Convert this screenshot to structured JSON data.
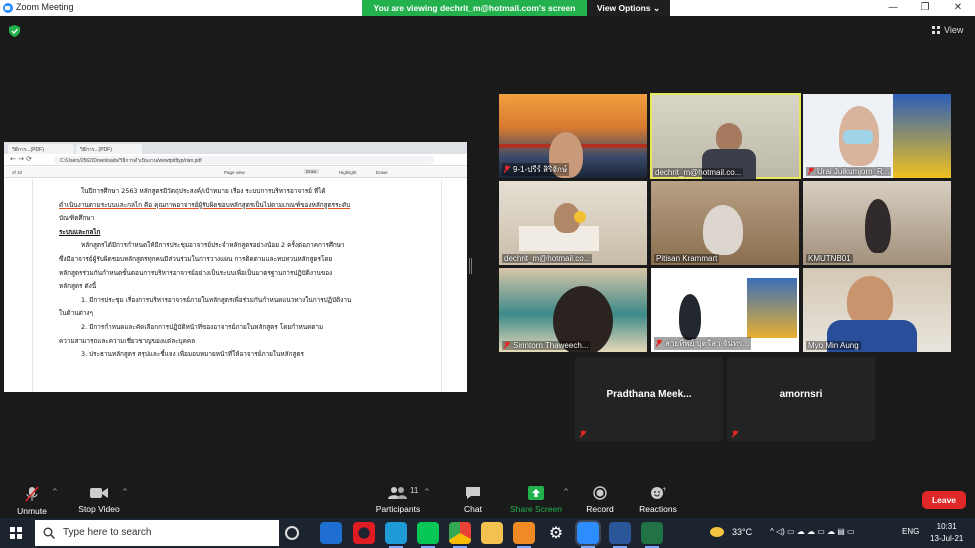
{
  "window": {
    "title": "Zoom Meeting"
  },
  "banner": {
    "message": "You are viewing dechrit_m@hotmail.com's screen",
    "view_options": "View Options ⌄"
  },
  "top": {
    "view_label": "View"
  },
  "shared_screen": {
    "tabs": [
      "วิธีการ...(PDF)",
      "วิธีการ...(PDF)"
    ],
    "url": "C:/Users/2562/Downloads/วิธีการดำเนินงาน/wewtpdftyp/rian.pdf",
    "pdf_toolbar": {
      "page": "of 10",
      "page_view": "Page view",
      "draw": "Draw",
      "highlight": "Highlight",
      "erase": "Erase"
    },
    "lines": [
      "ในปีการศึกษา 2563 หลักสูตรมีวัตถุประสงค์/เป้าหมาย เรื่อง ระบบการบริหารอาจารย์ ที่ได้",
      "ดำเนินงานตามระบบและกลไก คือ คุณภาพอาจารย์ผู้รับผิดชอบหลักสูตรเป็นไปตามเกณฑ์ของหลักสูตรระดับ",
      "บัณฑิตศึกษา",
      "ระบบและกลไก",
      "หลักสูตรได้มีการกำหนดให้มีการประชุมอาจารย์ประจำหลักสูตรอย่างน้อย 2 ครั้งต่อภาคการศึกษา",
      "ซึ่งมีอาจารย์ผู้รับผิดชอบหลักสูตรทุกคนมีส่วนร่วมในการวางแผน การติดตามและทบทวนหลักสูตรโดย",
      "หลักสูตรร่วมกันกำหนดขั้นตอนการบริหารอาจารย์อย่างเป็นระบบเพื่อเป็นมาตรฐานการปฏิบัติงานของ",
      "หลักสูตร ดังนี้",
      "1. มีการประชุม เรื่องการบริหารอาจารย์ภายในหลักสูตรเพื่อร่วมกันกำหนดแนวทางในการปฏิบัติงาน",
      "ในด้านต่างๆ",
      "2. มีการกำหนดและคัดเลือกการปฏิบัติหน้าที่ของอาจารย์ภายในหลักสูตร โดยกำหนดตาม",
      "ความสามารถและความเชี่ยวชาญของแต่ละบุคคล",
      "3. ประธานหลักสูตร สรุปและชี้แจง เพื่อมอบหมายหน้าที่ให้อาจารย์ภายในหลักสูตร"
    ]
  },
  "participants_grid": [
    {
      "name": "9-1-ปรีร์ สิริจักษ์",
      "muted": true
    },
    {
      "name": "dechrit_m@hotmail.co...",
      "muted": false
    },
    {
      "name": "Urai Juikumjorn_R...",
      "muted": true
    },
    {
      "name": "dechrit_m@hotmail.co...",
      "muted": false
    },
    {
      "name": "Pitisan Krammart",
      "muted": false
    },
    {
      "name": "KMUTNB01",
      "muted": false
    },
    {
      "name": "Sirintorn Thaweech...",
      "muted": true
    },
    {
      "name": "สายทิพย์ บุตรีสา จันทร...",
      "muted": true
    },
    {
      "name": "Myo Min Aung",
      "muted": false
    },
    {
      "name": "Pradthana  Meek...",
      "muted": true
    },
    {
      "name": "amornsri",
      "muted": true
    }
  ],
  "toolbar": {
    "unmute": "Unmute",
    "stop_video": "Stop Video",
    "participants": "Participants",
    "participants_count": "11",
    "chat": "Chat",
    "share_screen": "Share Screen",
    "record": "Record",
    "reactions": "Reactions",
    "leave": "Leave"
  },
  "taskbar": {
    "search_placeholder": "Type here to search",
    "temperature": "33°C",
    "language": "ENG",
    "time": "10:31",
    "date": "13-Jul-21"
  },
  "colors": {
    "share_green": "#23b14d",
    "leave_red": "#e02828",
    "active_speaker": "#e6e65a",
    "zoom_blue": "#2d8cff"
  }
}
